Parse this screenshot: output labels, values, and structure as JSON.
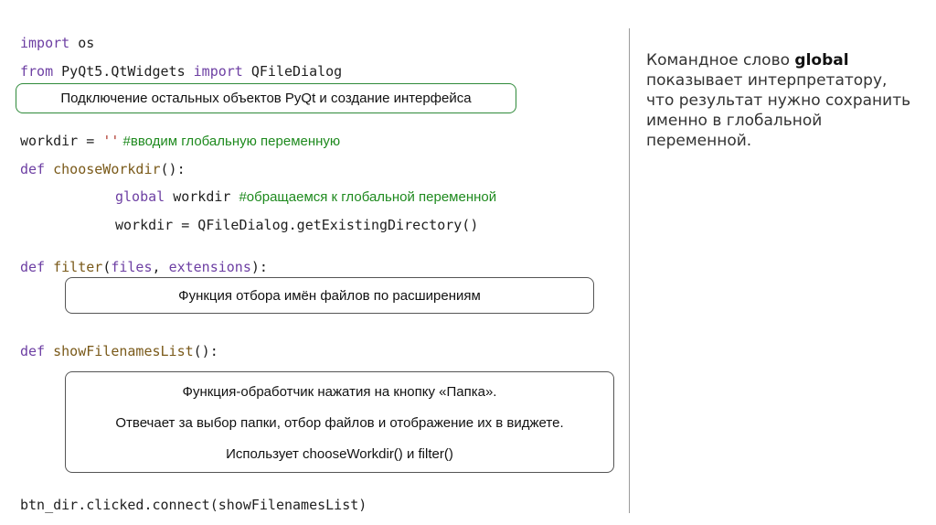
{
  "code": {
    "line1": {
      "kw": "import",
      "rest": " os"
    },
    "line2": {
      "kw1": "from",
      "mod": " PyQt5.QtWidgets ",
      "kw2": "import",
      "rest": " QFileDialog"
    },
    "box_imports": "Подключение остальных объектов PyQt и создание интерфейса",
    "line3": {
      "plain": "workdir = ",
      "str": "''",
      "comment": " #вводим глобальную переменную"
    },
    "line4": {
      "kw": "def",
      "fn": " chooseWorkdir",
      "rest": "():"
    },
    "line5": {
      "kw": "global",
      "plain": " workdir ",
      "comment": "#обращаемся к глобальной переменной"
    },
    "line6": {
      "plain": "workdir = QFileDialog.getExistingDirectory()"
    },
    "line7": {
      "kw": "def",
      "fn": " filter",
      "p1": "(",
      "a1": "files",
      "p2": ", ",
      "a2": "extensions",
      "p3": "):"
    },
    "box_filter": "Функция отбора имён файлов по расширениям",
    "line8": {
      "kw": "def",
      "fn": " showFilenamesList",
      "rest": "():"
    },
    "box_handler": [
      "Функция-обработчик нажатия на кнопку «Папка».",
      "Отвечает за выбор папки, отбор файлов и отображение их в виджете.",
      "Использует chooseWorkdir() и filter()"
    ],
    "line9": {
      "plain": "btn_dir.clicked.connect(showFilenamesList)"
    }
  },
  "note": {
    "pre": "Командное слово ",
    "bold": "global",
    "post": " показывает интерпретатору, что результат нужно сохранить именно в глобальной переменной."
  }
}
